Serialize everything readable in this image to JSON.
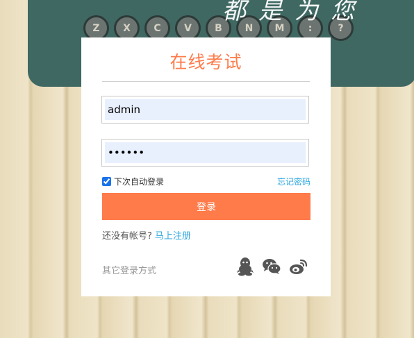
{
  "background": {
    "script_text": "都是为您",
    "keys": [
      "Z",
      "X",
      "C",
      "V",
      "B",
      "N",
      "M",
      ":",
      "?"
    ]
  },
  "login": {
    "title": "在线考试",
    "username_value": "admin",
    "password_value": "123456",
    "remember_label": "下次自动登录",
    "remember_checked": true,
    "forgot_label": "忘记密码",
    "submit_label": "登录",
    "no_account_text": "还没有帐号?",
    "register_link": "马上注册",
    "other_login_label": "其它登录方式",
    "social_icons": [
      "qq-icon",
      "wechat-icon",
      "weibo-icon"
    ]
  },
  "colors": {
    "accent": "#ff7b4a",
    "link": "#2aa6e0",
    "input_bg": "#e8f0fe"
  }
}
